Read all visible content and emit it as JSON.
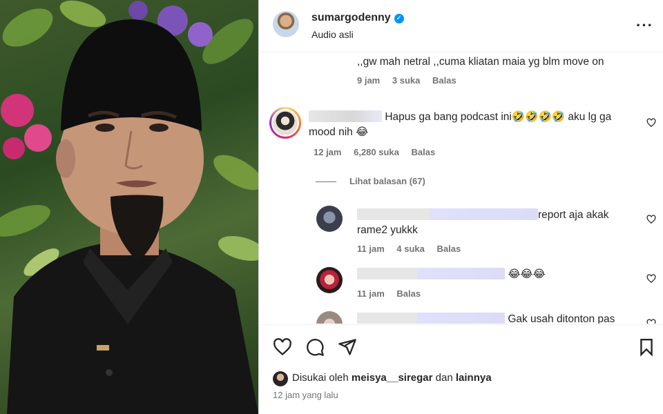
{
  "post": {
    "username": "sumargodenny",
    "audio": "Audio asli",
    "more_icon": "more-horizontal-icon"
  },
  "comments": [
    {
      "text": ",,gw mah netral ,,cuma kliatan maia yg blm move on",
      "time": "9 jam",
      "likes": "3 suka",
      "reply": "Balas"
    },
    {
      "text_a": "Hapus ga bang podcast ini🤣🤣🤣🤣 aku lg ga",
      "text_b": "mood nih 😂",
      "time": "12 jam",
      "likes": "6,280 suka",
      "reply": "Balas",
      "view_replies": "Lihat balasan (67)"
    }
  ],
  "replies": [
    {
      "text_a": "report aja akak",
      "text_b": "rame2 yukkk",
      "time": "11 jam",
      "likes": "4 suka",
      "reply": "Balas"
    },
    {
      "text": "😂😂😂",
      "time": "11 jam",
      "reply": "Balas"
    },
    {
      "text": "Gak usah ditonton pas"
    }
  ],
  "footer": {
    "liked_prefix": "Disukai oleh",
    "liked_user": "meisya__siregar",
    "liked_and": "dan",
    "liked_others": "lainnya",
    "posted_ago": "12 jam yang lalu"
  }
}
